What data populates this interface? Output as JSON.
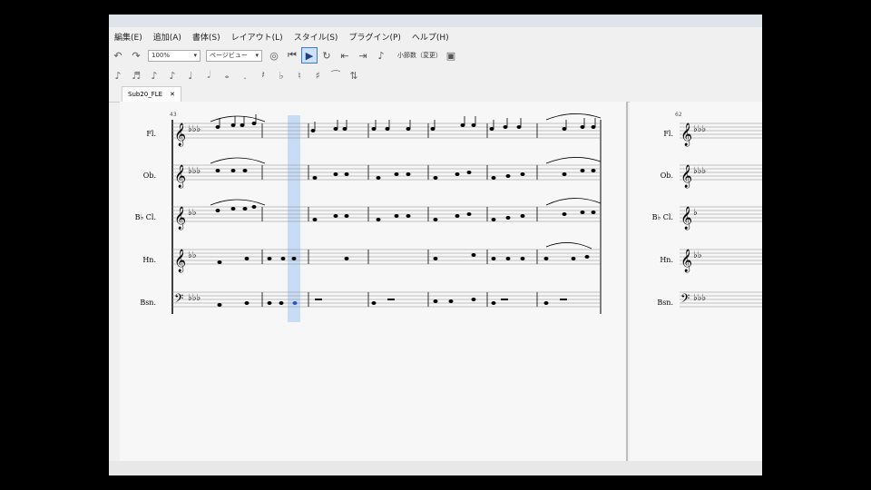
{
  "menu": [
    "編集(E)",
    "追加(A)",
    "書体(S)",
    "レイアウト(L)",
    "スタイル(S)",
    "プラグイン(P)",
    "ヘルプ(H)"
  ],
  "toolbar": {
    "zoom": "100%",
    "view": "ページビュー",
    "countin": "小節数（変更）"
  },
  "tab": {
    "label": "Sub20_FLE"
  },
  "score": {
    "measure_number_1": "43",
    "measure_number_2": "62",
    "instruments": [
      "Fl.",
      "Ob.",
      "B♭ Cl.",
      "Hn.",
      "Bsn."
    ]
  }
}
